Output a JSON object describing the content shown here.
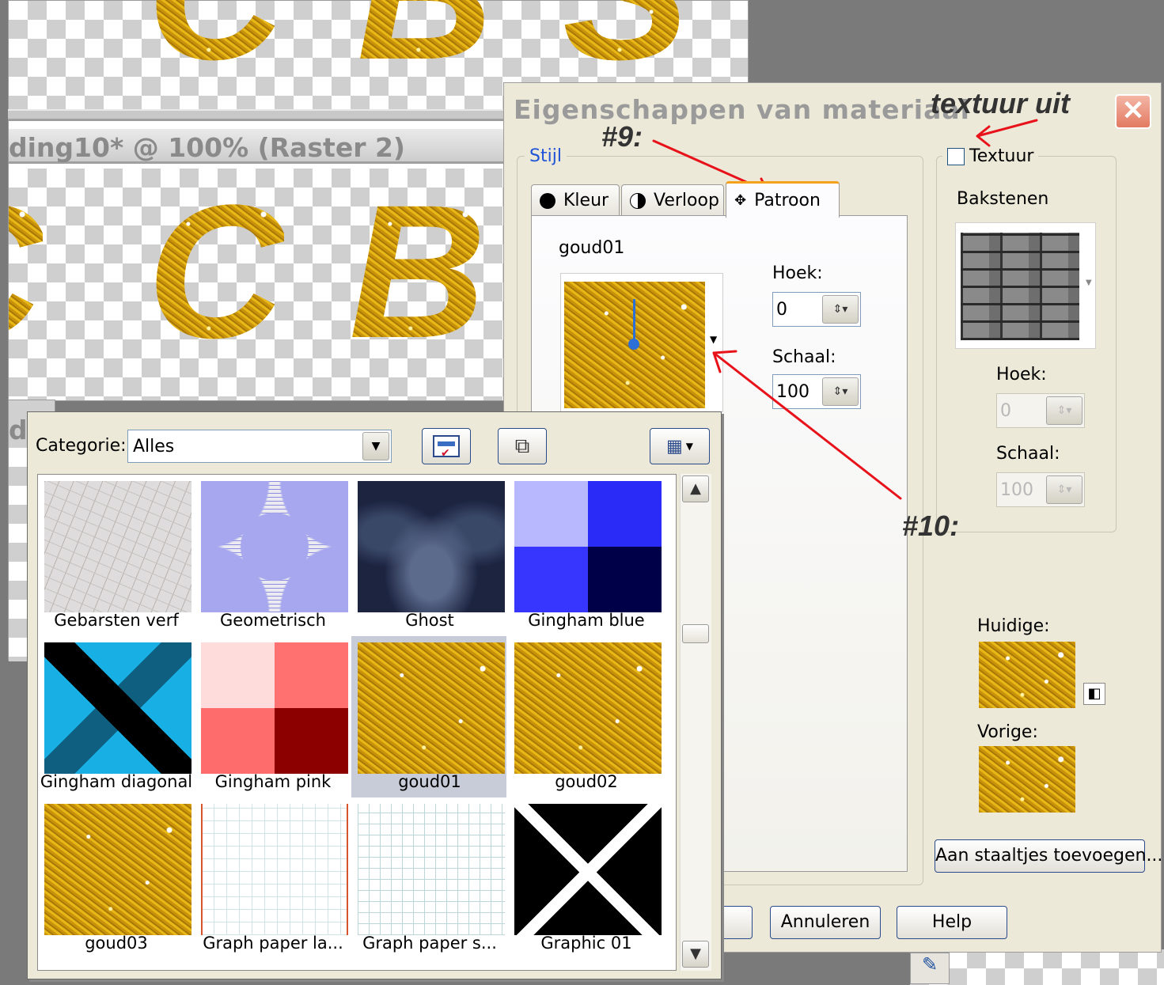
{
  "background_window": {
    "title": "ding10* @ 100% (Raster 2)",
    "second_title_fragment": "d",
    "top_letters": [
      "C",
      "B",
      "S"
    ],
    "main_letters": [
      "C",
      "C",
      "B"
    ]
  },
  "dialog": {
    "title": "Eigenschappen van materiaal",
    "style_group_label": "Stijl",
    "tabs": [
      {
        "label": "Kleur",
        "icon": "circle-icon"
      },
      {
        "label": "Verloop",
        "icon": "gradient-circle-icon"
      },
      {
        "label": "Patroon",
        "icon": "pattern-icon",
        "active": true
      }
    ],
    "pattern_name": "goud01",
    "angle_label": "Hoek:",
    "angle_value": "0",
    "scale_label": "Schaal:",
    "scale_value": "100",
    "texture_checkbox_label": "Textuur",
    "texture_checked": false,
    "texture_name": "Bakstenen",
    "texture_angle_label": "Hoek:",
    "texture_angle_value": "0",
    "texture_scale_label": "Schaal:",
    "texture_scale_value": "100",
    "current_label": "Huidige:",
    "previous_label": "Vorige:",
    "add_swatches_button": "Aan staaltjes toevoegen...",
    "cancel_button": "Annuleren",
    "help_button": "Help"
  },
  "annotations": {
    "texture_off": "textuur uit",
    "step9": "#9:",
    "step10": "#10:",
    "arrow_color": "#e8121a"
  },
  "pattern_picker": {
    "category_label": "Categorie:",
    "category_value": "Alles",
    "items": [
      {
        "label": "Gebarsten verf"
      },
      {
        "label": "Geometrisch"
      },
      {
        "label": "Ghost"
      },
      {
        "label": "Gingham blue"
      },
      {
        "label": "Gingham diagonal"
      },
      {
        "label": "Gingham pink"
      },
      {
        "label": "goud01",
        "selected": true
      },
      {
        "label": "goud02"
      },
      {
        "label": "goud03"
      },
      {
        "label": "Graph paper la..."
      },
      {
        "label": "Graph paper s..."
      },
      {
        "label": "Graphic 01"
      }
    ]
  }
}
